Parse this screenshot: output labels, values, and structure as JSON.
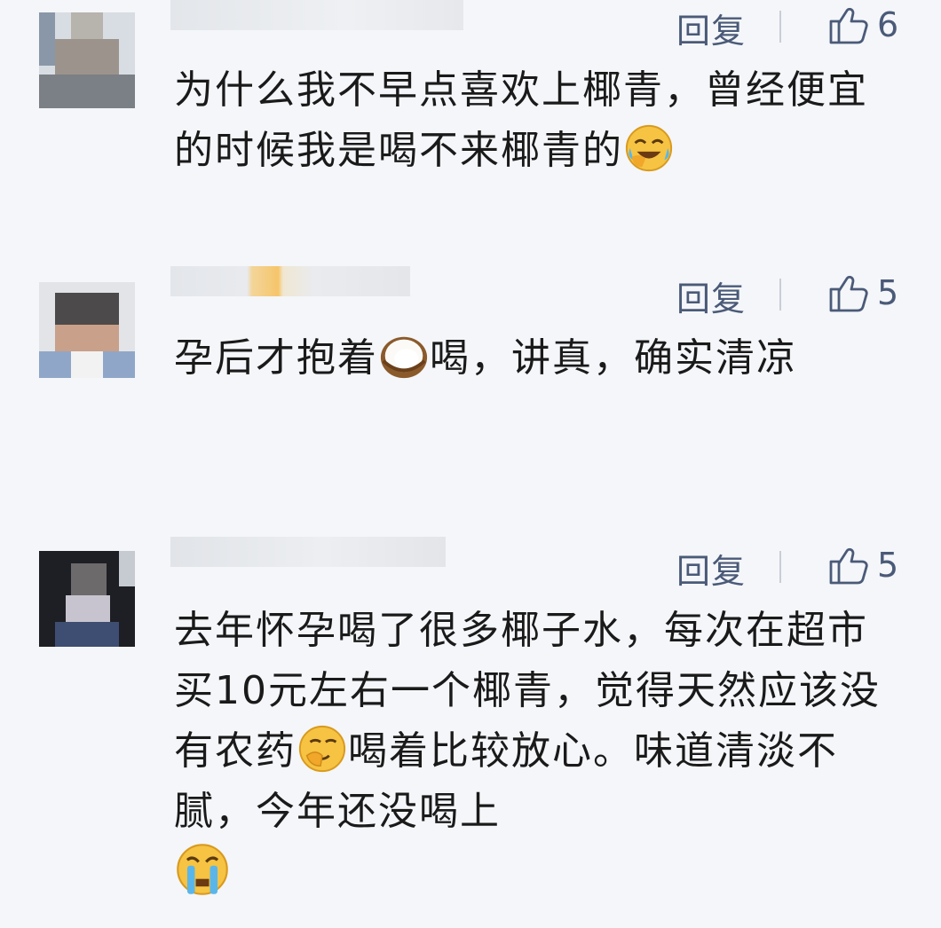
{
  "reply_label": "回复",
  "comments": [
    {
      "likes": "6",
      "text_parts": [
        "为什么我不早点喜欢上椰青，曾经便宜的时候我是喝不来椰青的"
      ],
      "emoji_names": [
        "laugh-cry-emoji"
      ]
    },
    {
      "likes": "5",
      "text_parts": [
        "孕后才抱着",
        "喝，讲真，确实清凉"
      ],
      "emoji_names": [
        "coconut-emoji"
      ]
    },
    {
      "likes": "5",
      "text_parts": [
        "去年怀孕喝了很多椰子水，每次在超市买10元左右一个椰青，觉得天然应该没有农药",
        "喝着比较放心。味道清淡不腻，今年还没喝上"
      ],
      "emoji_names": [
        "smirk-emoji",
        "crying-emoji"
      ]
    }
  ],
  "colors": {
    "background": "#f4f6f9",
    "action_text": "#4a5a78",
    "body_text": "#1a1a1a"
  }
}
